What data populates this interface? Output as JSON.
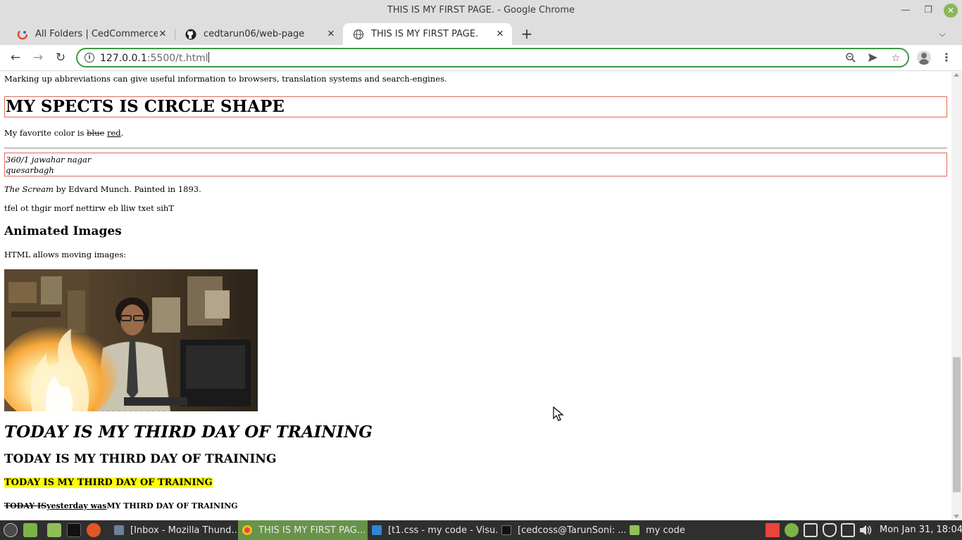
{
  "window": {
    "title": "THIS IS MY FIRST PAGE. - Google Chrome"
  },
  "tabs": [
    {
      "label": "All Folders | CedCommerce (L",
      "icon": "cedcommerce-icon",
      "active": false
    },
    {
      "label": "cedtarun06/web-page",
      "icon": "github-icon",
      "active": false
    },
    {
      "label": "THIS IS MY FIRST PAGE.",
      "icon": "globe-icon",
      "active": true
    }
  ],
  "toolbar": {
    "url_host": "127.0.0.1",
    "url_path": ":5500/t.html"
  },
  "page": {
    "abbr_text": "Marking up abbreviations can give useful information to browsers, translation systems and search-engines.",
    "boxed_heading": "MY SPECTS IS CIRCLE SHAPE",
    "favorite_prefix": "My favorite color is ",
    "favorite_deleted": "blue",
    "favorite_inserted": "red",
    "favorite_suffix": ".",
    "address_line1": "360/1 jawahar nagar",
    "address_line2": "quesarbagh",
    "scream_title": "The Scream",
    "scream_rest": " by Edvard Munch. Painted in 1893.",
    "reversed_text": "tfel ot thgir morf nettirw eb lliw txet sihT",
    "animated_heading": "Animated Images",
    "moving_text": "HTML allows moving images:",
    "training_italic": "TODAY IS MY THIRD DAY OF TRAINING",
    "training_plain": "TODAY IS MY THIRD DAY OF TRAINING",
    "training_marked": "TODAY IS MY THIRD DAY OF TRAINING",
    "training_deleted": "TODAY IS",
    "training_inserted": "yesterday was",
    "training_rest": "MY THIRD DAY OF TRAINING"
  },
  "taskbar": {
    "tasks": [
      {
        "label": "[Inbox - Mozilla Thund...",
        "icon": "thunderbird-icon",
        "active": false
      },
      {
        "label": "THIS IS MY FIRST PAG...",
        "icon": "chrome-icon",
        "active": true
      },
      {
        "label": "[t1.css - my code - Visu...",
        "icon": "vscode-icon",
        "active": false
      },
      {
        "label": "[cedcoss@TarunSoni: ...",
        "icon": "terminal-icon",
        "active": false
      },
      {
        "label": "my code",
        "icon": "folder-icon",
        "active": false
      }
    ],
    "clock": "Mon Jan 31, 18:04"
  },
  "colors": {
    "omnibox_focus": "#3b9a42",
    "box_border": "#e06a5a",
    "highlight": "#ffff00",
    "taskbar_active": "#68934a",
    "taskbar_bg": "#2f2f2f"
  }
}
